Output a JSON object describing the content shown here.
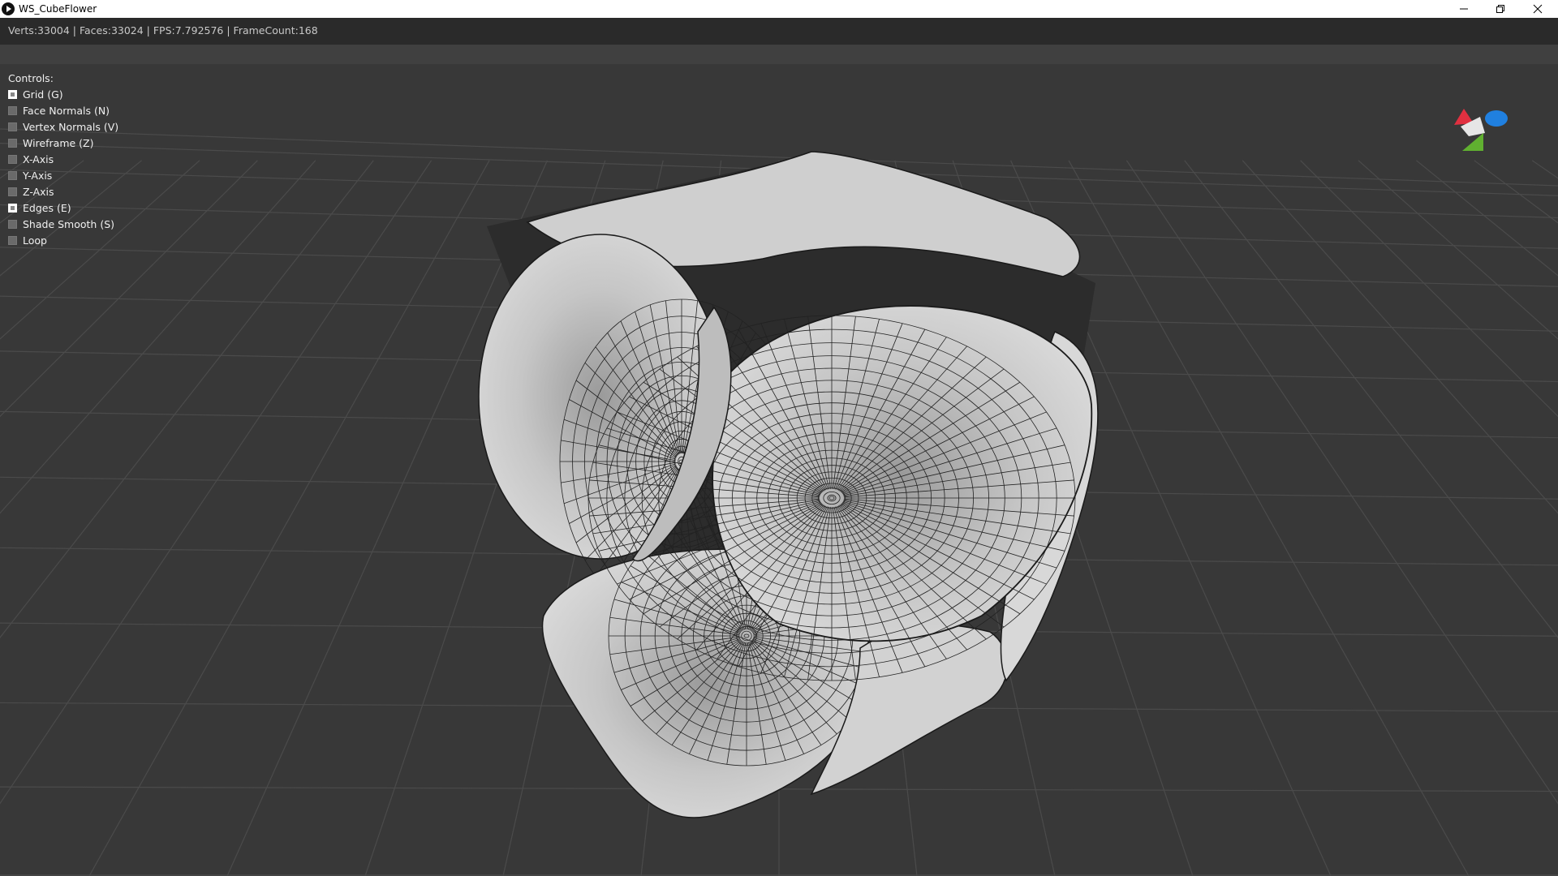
{
  "window": {
    "title": "WS_CubeFlower",
    "icon": "play-app-icon"
  },
  "stats": {
    "text": "Verts:33004 | Faces:33024 | FPS:7.792576 | FrameCount:168"
  },
  "controls": {
    "title": "Controls:",
    "items": [
      {
        "label": "Grid (G)",
        "checked": true
      },
      {
        "label": "Face Normals (N)",
        "checked": false
      },
      {
        "label": "Vertex Normals (V)",
        "checked": false
      },
      {
        "label": "Wireframe (Z)",
        "checked": false
      },
      {
        "label": "X-Axis",
        "checked": false
      },
      {
        "label": "Y-Axis",
        "checked": false
      },
      {
        "label": "Z-Axis",
        "checked": false
      },
      {
        "label": "Edges (E)",
        "checked": true
      },
      {
        "label": "Shade Smooth (S)",
        "checked": false
      },
      {
        "label": "Loop",
        "checked": false
      }
    ]
  },
  "colors": {
    "viewport_bg": "#383838",
    "grid_line": "#4a4a4a",
    "mesh_fill": "#c4c4c4",
    "mesh_edge": "#1a1a1a",
    "axis_x": "#e03040",
    "axis_y": "#60b030",
    "axis_z": "#2080e0"
  },
  "viewport": {
    "object": "cube-flower-mesh",
    "gizmo": "orientation-gizmo-icon"
  }
}
